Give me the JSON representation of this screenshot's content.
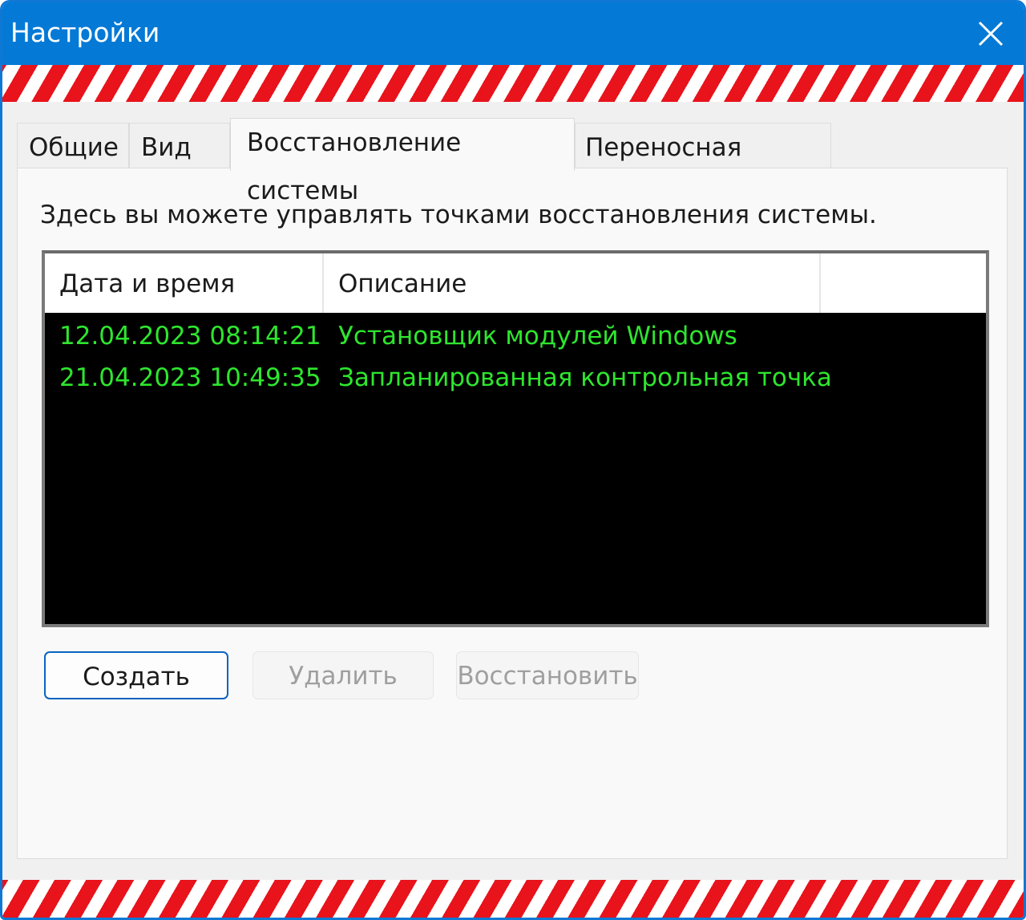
{
  "window": {
    "title": "Настройки"
  },
  "tabs": [
    {
      "label": "Общие"
    },
    {
      "label": "Вид"
    },
    {
      "label": "Восстановление системы"
    },
    {
      "label": "Переносная версия"
    }
  ],
  "active_tab": "Восстановление системы",
  "panel": {
    "description": "Здесь вы можете управлять точками восстановления системы."
  },
  "restore_points": {
    "columns": [
      {
        "label": "Дата и время"
      },
      {
        "label": "Описание"
      },
      {
        "label": ""
      }
    ],
    "rows": [
      {
        "datetime": "12.04.2023 08:14:21",
        "description": "Установщик модулей Windows"
      },
      {
        "datetime": "21.04.2023 10:49:35",
        "description": "Запланированная контрольная точка"
      }
    ]
  },
  "buttons": {
    "create": "Создать",
    "delete": "Удалить",
    "restore": "Восстановить"
  },
  "colors": {
    "titlebar": "#0479d6",
    "stripe_red": "#e8131b",
    "list_background": "#000000",
    "list_text": "#2ee62e",
    "primary_border": "#0a64c0"
  },
  "icons": {
    "close": "close-icon"
  }
}
